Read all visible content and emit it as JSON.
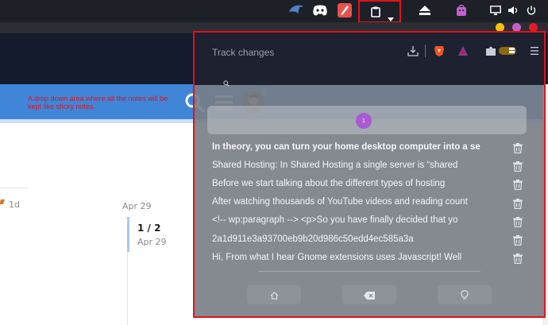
{
  "panel": {
    "tray_icons": [
      "kde-connect-icon",
      "discord-icon",
      "pen-tool-icon",
      "clipboard-icon",
      "eject-icon",
      "bag-icon",
      "display-icon",
      "volume-icon",
      "power-icon"
    ]
  },
  "window_controls": {
    "colors": [
      "#f5c211",
      "#c061cb",
      "#e01b24"
    ]
  },
  "site_header": {
    "annotation": "A drop down area where all the notes will be kept like sticky notes.",
    "avatar_badge": "1"
  },
  "content": {
    "days": "1d",
    "date": "Apr 29",
    "timeline_count": "1 / 2",
    "timeline_date": "Apr 29"
  },
  "popup": {
    "title": "Track changes",
    "search_pill": "1",
    "items": [
      "In theory, you can turn your home desktop computer into a se",
      "Shared Hosting: In Shared Hosting a single server is “shared",
      "Before we start talking about the different types of hosting",
      "After watching thousands of YouTube videos and reading count",
      "<!-- wp:paragraph --> <p>So you have finally decided that yo",
      "2a1d911e3a93700eb9b20d986c50edd4ec585a3a",
      "Hi,  From what I hear Gnome extensions uses Javascript! Well"
    ],
    "buttons": [
      "home-icon",
      "backspace-icon",
      "lightbulb-icon"
    ]
  },
  "colors": {
    "highlight_border": "#e0121c",
    "header_blue": "#3f86d9",
    "popup_bg": "#787d85"
  }
}
